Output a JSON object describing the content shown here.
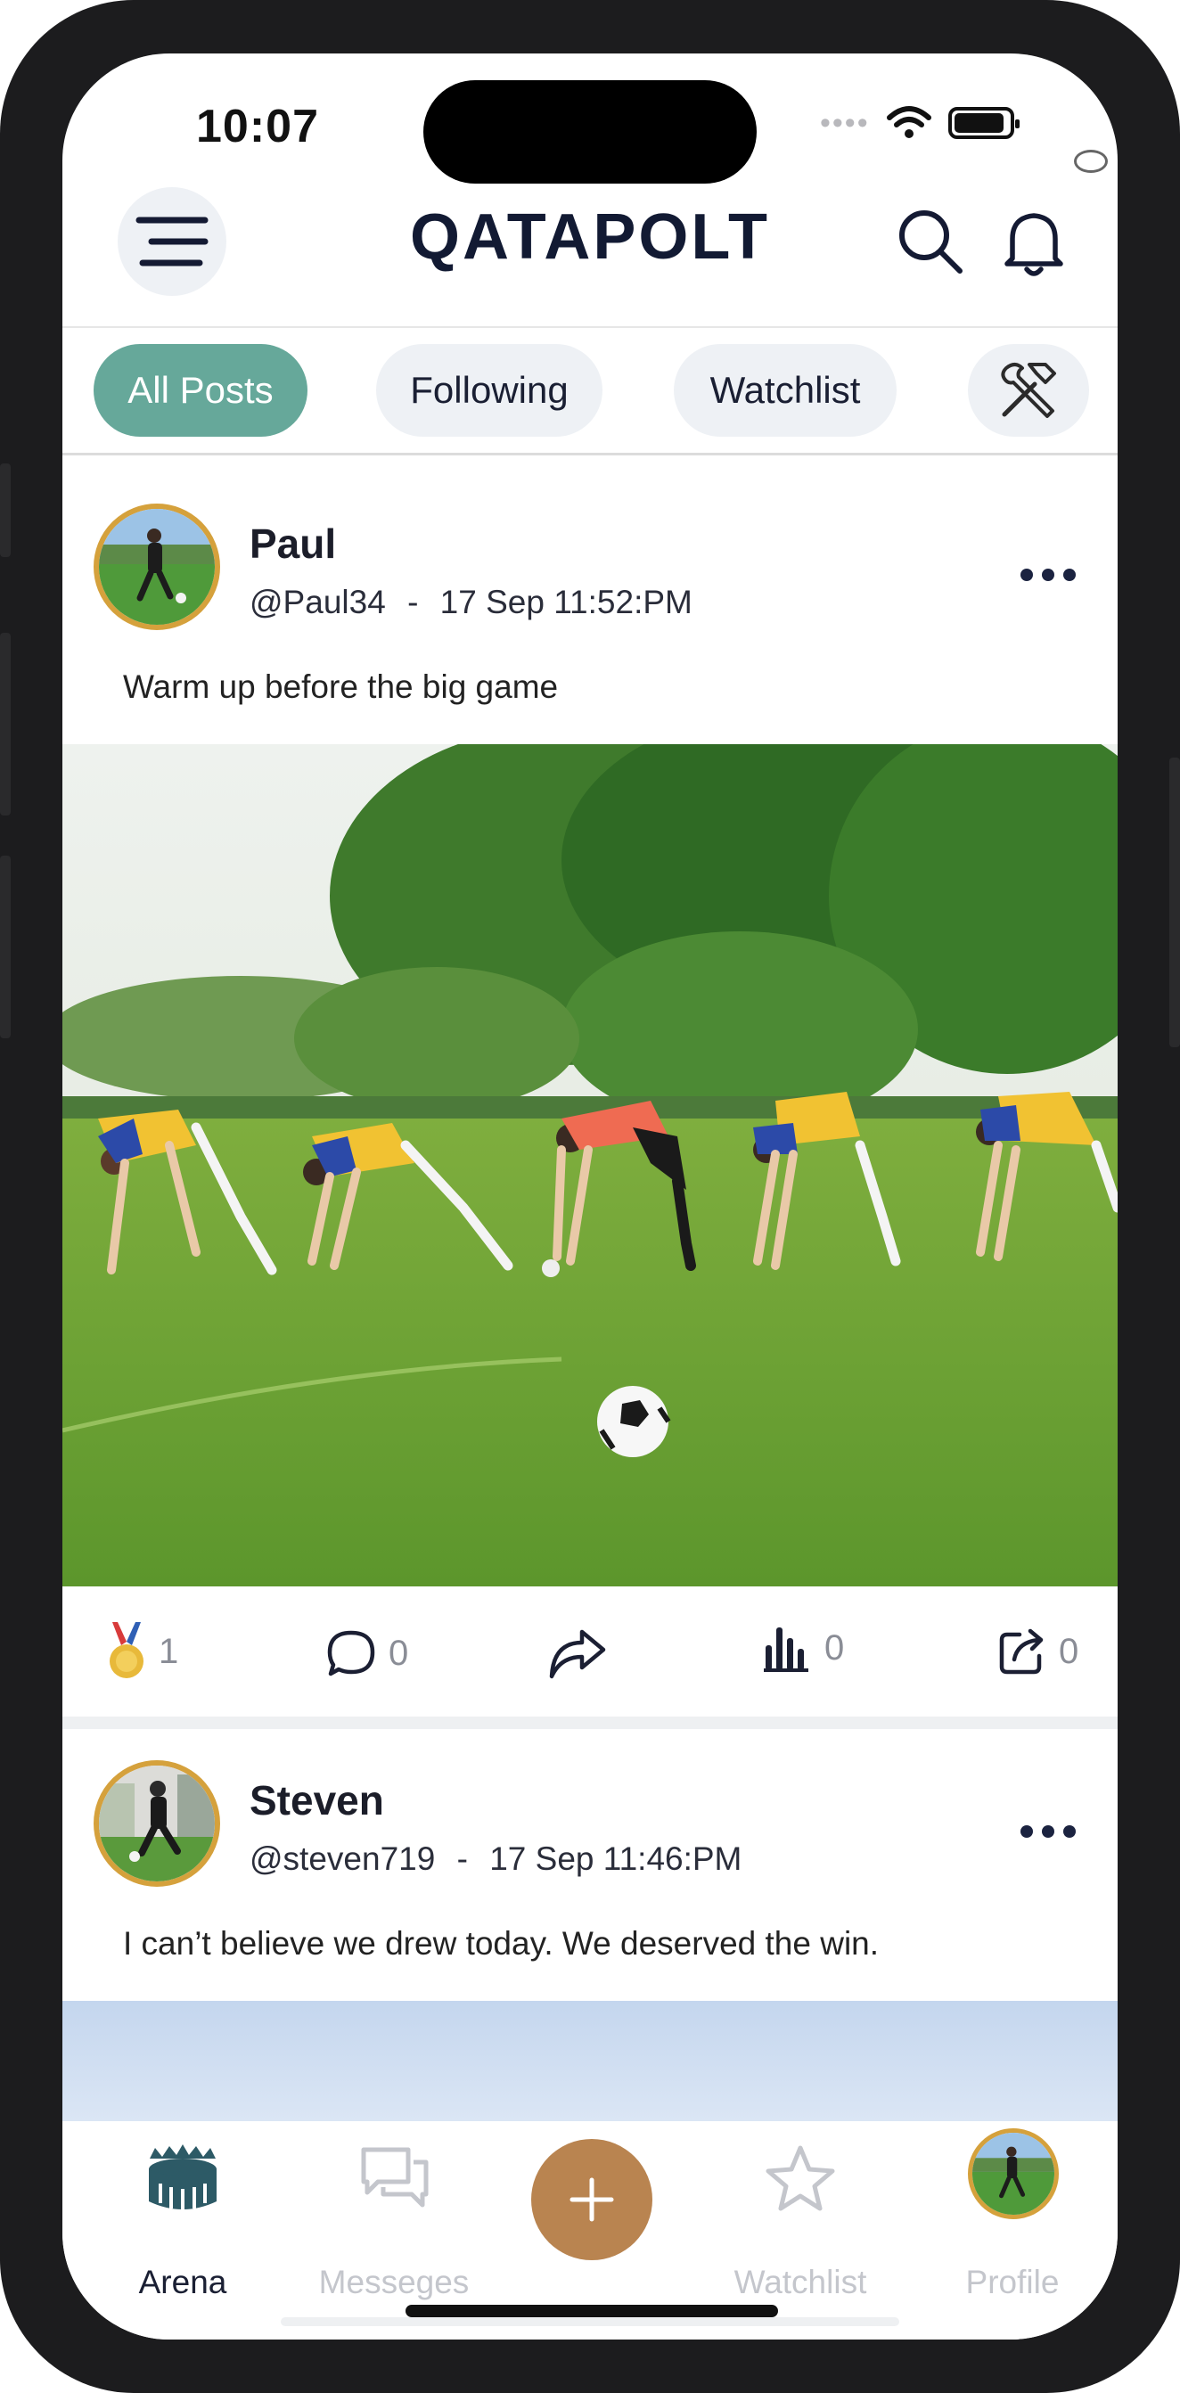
{
  "status_bar": {
    "time": "10:07"
  },
  "header": {
    "brand": "QATAPOLT"
  },
  "tabs": [
    {
      "label": "All Posts",
      "active": true
    },
    {
      "label": "Following",
      "active": false
    },
    {
      "label": "Watchlist",
      "active": false
    }
  ],
  "posts": [
    {
      "name": "Paul",
      "handle": "@Paul34",
      "separator": "-",
      "timestamp": "17 Sep 11:52:PM",
      "text": "Warm up before the big game",
      "actions": {
        "medals": "1",
        "comments": "0",
        "views": "0",
        "shares": "0"
      }
    },
    {
      "name": "Steven",
      "handle": "@steven719",
      "separator": "-",
      "timestamp": "17 Sep 11:46:PM",
      "text": "I can’t believe we drew today. We deserved the win."
    }
  ],
  "bottom_nav": [
    {
      "label": "Arena",
      "icon": "stadium-icon",
      "active": true
    },
    {
      "label": "Messeges",
      "icon": "chat-icon",
      "active": false
    },
    {
      "label": "",
      "icon": "plus-icon",
      "active": false
    },
    {
      "label": "Watchlist",
      "icon": "star-icon",
      "active": false
    },
    {
      "label": "Profile",
      "icon": "avatar",
      "active": false
    }
  ],
  "colors": {
    "accent_tab": "#66a89a",
    "fab": "#b98450",
    "avatar_ring": "#d5a13c",
    "brand_text": "#121a33"
  }
}
